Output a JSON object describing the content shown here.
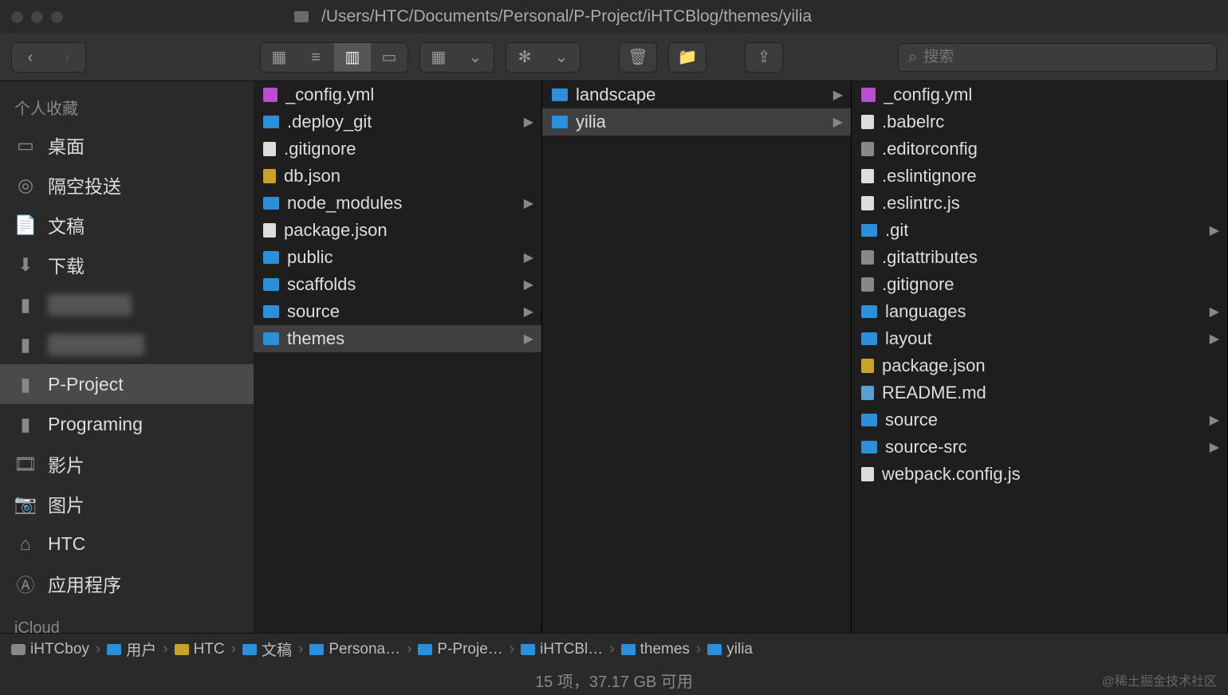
{
  "window": {
    "path": "/Users/HTC/Documents/Personal/P-Project/iHTCBlog/themes/yilia"
  },
  "search": {
    "placeholder": "搜索"
  },
  "sidebar": {
    "header": "个人收藏",
    "items": [
      {
        "icon": "desktop",
        "label": "桌面"
      },
      {
        "icon": "airdrop",
        "label": "隔空投送"
      },
      {
        "icon": "documents",
        "label": "文稿"
      },
      {
        "icon": "downloads",
        "label": "下载"
      },
      {
        "icon": "folder",
        "label": "████",
        "blurred": true
      },
      {
        "icon": "folder",
        "label": "█████",
        "blurred": true
      },
      {
        "icon": "folder",
        "label": "P-Project",
        "selected": true
      },
      {
        "icon": "folder",
        "label": "Programing"
      },
      {
        "icon": "movies",
        "label": "影片"
      },
      {
        "icon": "pictures",
        "label": "图片"
      },
      {
        "icon": "home",
        "label": "HTC"
      },
      {
        "icon": "apps",
        "label": "应用程序"
      }
    ],
    "footer": "iCloud"
  },
  "columns": [
    {
      "items": [
        {
          "type": "file",
          "sub": "yml",
          "label": "_config.yml"
        },
        {
          "type": "folder",
          "label": ".deploy_git",
          "arrow": true
        },
        {
          "type": "file",
          "label": ".gitignore"
        },
        {
          "type": "file",
          "sub": "json",
          "label": "db.json"
        },
        {
          "type": "folder",
          "label": "node_modules",
          "arrow": true
        },
        {
          "type": "file",
          "label": "package.json"
        },
        {
          "type": "folder",
          "label": "public",
          "arrow": true
        },
        {
          "type": "folder",
          "label": "scaffolds",
          "arrow": true
        },
        {
          "type": "folder",
          "label": "source",
          "arrow": true
        },
        {
          "type": "folder",
          "label": "themes",
          "arrow": true,
          "selected": true
        }
      ]
    },
    {
      "items": [
        {
          "type": "folder",
          "label": "landscape",
          "arrow": true
        },
        {
          "type": "folder",
          "label": "yilia",
          "arrow": true,
          "selected": true
        }
      ]
    },
    {
      "items": [
        {
          "type": "file",
          "sub": "yml",
          "label": "_config.yml"
        },
        {
          "type": "file",
          "label": ".babelrc"
        },
        {
          "type": "file",
          "sub": "gear",
          "label": ".editorconfig"
        },
        {
          "type": "file",
          "label": ".eslintignore"
        },
        {
          "type": "file",
          "label": ".eslintrc.js"
        },
        {
          "type": "folder",
          "label": ".git",
          "arrow": true
        },
        {
          "type": "file",
          "sub": "gear",
          "label": ".gitattributes"
        },
        {
          "type": "file",
          "sub": "gear",
          "label": ".gitignore"
        },
        {
          "type": "folder",
          "label": "languages",
          "arrow": true
        },
        {
          "type": "folder",
          "label": "layout",
          "arrow": true
        },
        {
          "type": "file",
          "sub": "json",
          "label": "package.json"
        },
        {
          "type": "file",
          "sub": "md",
          "label": "README.md"
        },
        {
          "type": "folder",
          "label": "source",
          "arrow": true
        },
        {
          "type": "folder",
          "label": "source-src",
          "arrow": true
        },
        {
          "type": "file",
          "label": "webpack.config.js"
        }
      ]
    }
  ],
  "pathbar": [
    {
      "icon": "disk",
      "label": "iHTCboy"
    },
    {
      "icon": "user",
      "label": "用户"
    },
    {
      "icon": "home",
      "label": "HTC"
    },
    {
      "icon": "folder",
      "label": "文稿"
    },
    {
      "icon": "folder",
      "label": "Persona…"
    },
    {
      "icon": "folder",
      "label": "P-Proje…"
    },
    {
      "icon": "folder",
      "label": "iHTCBl…"
    },
    {
      "icon": "folder",
      "label": "themes"
    },
    {
      "icon": "folder",
      "label": "yilia"
    }
  ],
  "status": {
    "text": "15 项，37.17 GB 可用",
    "watermark": "@稀土掘金技术社区"
  }
}
